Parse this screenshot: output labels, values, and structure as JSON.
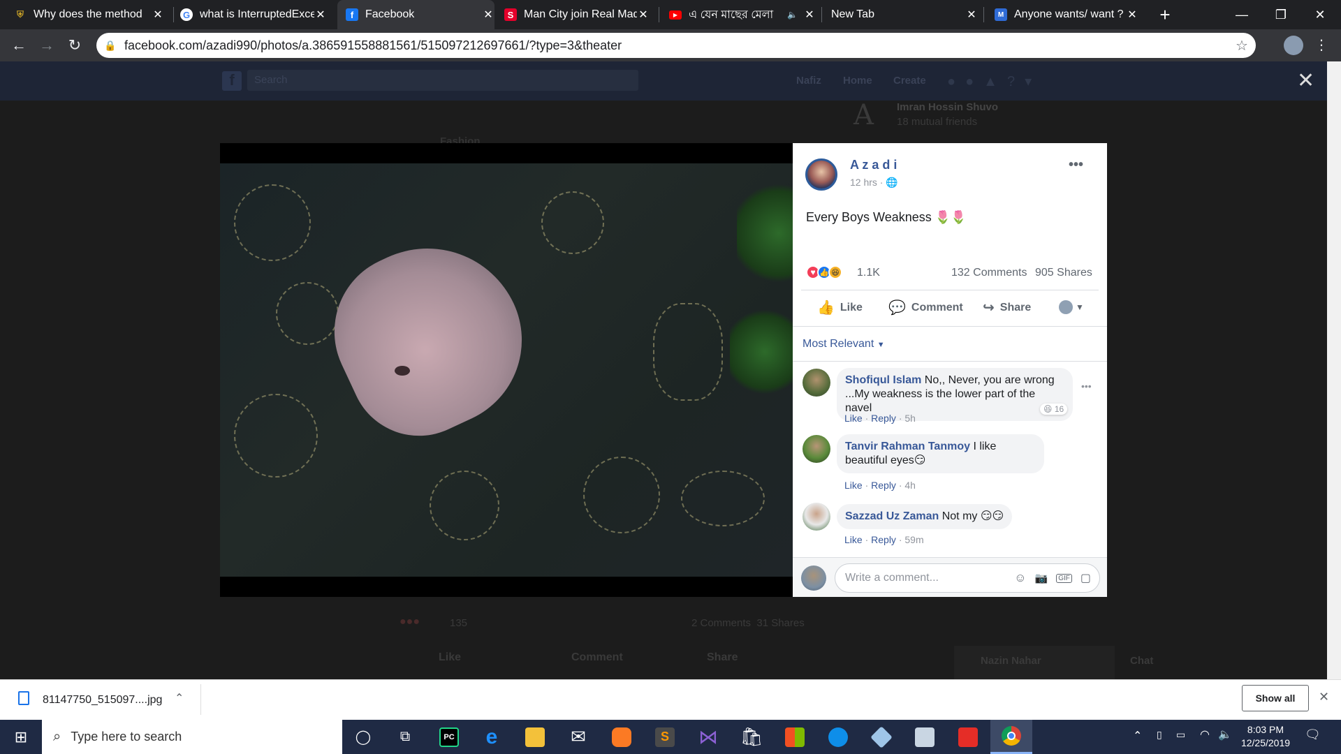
{
  "browser": {
    "tabs": [
      {
        "title": "Why does the method",
        "icon": "shield-icon",
        "color": "#c9a227"
      },
      {
        "title": "what is InterruptedExce",
        "icon": "google-icon",
        "color": "#ffffff"
      },
      {
        "title": "Facebook",
        "icon": "facebook-icon",
        "color": "#1877f2",
        "active": true
      },
      {
        "title": "Man City join Real Mad",
        "icon": "s-icon",
        "color": "#e4002b"
      },
      {
        "title": "এ যেন মাছের মেলা",
        "icon": "youtube-icon",
        "color": "#ff0000"
      },
      {
        "title": "New Tab",
        "icon": "none",
        "color": ""
      },
      {
        "title": "Anyone wants/ want ?",
        "icon": "ms-icon",
        "color": "#2f6bd6"
      }
    ],
    "url": "facebook.com/azadi990/photos/a.386591558881561/515097212697661/?type=3&theater"
  },
  "fb_background": {
    "search_placeholder": "Search",
    "nav": [
      "Nafiz",
      "Home",
      "Create"
    ],
    "profile_name": "Imran Hossin Shuvo",
    "mutual": "18 mutual friends",
    "reaction_count": "135",
    "comments_shares": "2 Comments  31 Shares",
    "actions": [
      "Like",
      "Comment",
      "Share"
    ],
    "chat_user": "Nazin Nahar",
    "chat_label": "Chat",
    "post_prefix": "Fashion"
  },
  "post": {
    "author": "A z a d i",
    "time": "12 hrs",
    "caption": "Every Boys Weakness 🌷🌷",
    "reactions_count": "1.1K",
    "comments": "132 Comments",
    "shares": "905 Shares",
    "actions": {
      "like": "Like",
      "comment": "Comment",
      "share": "Share"
    },
    "sort_label": "Most Relevant",
    "comment_list": [
      {
        "name": "Shofiqul Islam",
        "text": "No,, Never, you are wrong ...My weakness is the lower part of the navel",
        "reply": "Reply",
        "like": "Like",
        "time": "5h",
        "reaction_count": "16"
      },
      {
        "name": "Tanvir Rahman Tanmoy",
        "text": "I like beautiful eyes😏",
        "reply": "Reply",
        "like": "Like",
        "time": "4h"
      },
      {
        "name": "Sazzad Uz Zaman",
        "text": "Not my 😏😏",
        "reply": "Reply",
        "like": "Like",
        "time": "59m"
      }
    ],
    "write_placeholder": "Write a comment..."
  },
  "download": {
    "file": "81147750_515097....jpg",
    "show_all": "Show all"
  },
  "taskbar": {
    "search_placeholder": "Type here to search",
    "time": "8:03 PM",
    "date": "12/25/2019"
  }
}
